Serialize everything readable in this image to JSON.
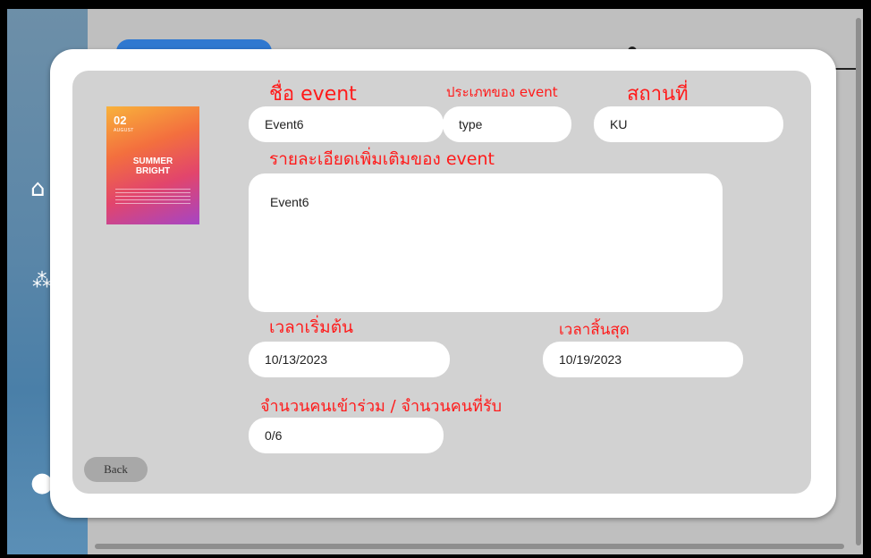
{
  "window": {
    "title": ""
  },
  "event": {
    "poster": {
      "date": "02",
      "month": "AUGUST",
      "title_line1": "SUMMER",
      "title_line2": "BRIGHT"
    },
    "labels": {
      "name": "ชื่อ event",
      "type": "ประเภทของ event",
      "location": "สถานที่",
      "details": "รายละเอียดเพิ่มเติมของ  event",
      "start": "เวลาเริ่มต้น",
      "end": "เวลาสิ้นสุด",
      "participants": "จำนวนคนเข้าร่วม / จำนวนคนที่รับ"
    },
    "values": {
      "name": "Event6",
      "type": "type",
      "location": "KU",
      "details": "Event6",
      "start": "10/13/2023",
      "end": "10/19/2023",
      "participants": "0/6"
    },
    "back_label": "Back"
  },
  "colors": {
    "label": "#ff1a1a",
    "panel": "#d2d2d2",
    "modal": "#ffffff",
    "accent": "#2f78d0"
  }
}
